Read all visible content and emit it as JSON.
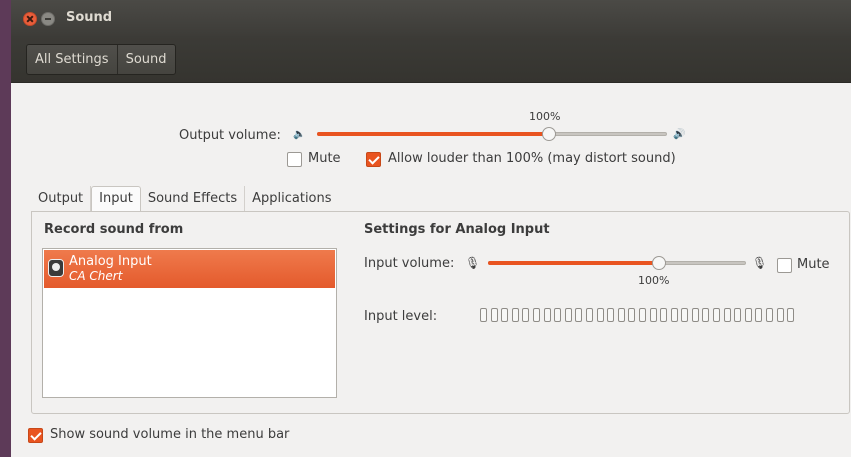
{
  "window": {
    "title": "Sound"
  },
  "breadcrumb": {
    "all_settings": "All Settings",
    "current": "Sound"
  },
  "output": {
    "label": "Output volume:",
    "percent": "100%",
    "volume_fraction": 0.66,
    "mute_label": "Mute",
    "mute_checked": false,
    "louder_label": "Allow louder than 100% (may distort sound)",
    "louder_checked": true
  },
  "tabs": [
    "Output",
    "Input",
    "Sound Effects",
    "Applications"
  ],
  "active_tab": "Input",
  "input": {
    "record_from_heading": "Record sound from",
    "devices": [
      {
        "name": "Analog Input",
        "description": "CA Chert",
        "selected": true
      }
    ],
    "settings_heading": "Settings for Analog Input",
    "volume_label": "Input volume:",
    "volume_percent": "100%",
    "volume_fraction": 0.66,
    "mute_label": "Mute",
    "mute_checked": false,
    "level_label": "Input level:",
    "level_segments": 30
  },
  "footer": {
    "show_volume_label": "Show sound volume in the menu bar",
    "show_volume_checked": true
  },
  "colors": {
    "accent": "#e95420",
    "titlebar": "#3c3b37"
  },
  "icons": [
    "close-icon",
    "minimize-icon",
    "speaker-low-icon",
    "speaker-high-icon",
    "microphone-low-icon",
    "microphone-high-icon",
    "webcam-mic-icon"
  ]
}
